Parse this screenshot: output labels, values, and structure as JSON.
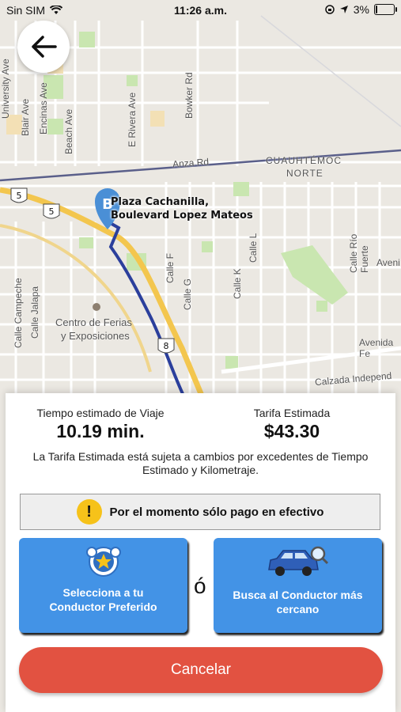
{
  "status_bar": {
    "carrier": "Sin SIM",
    "time": "11:26 a.m.",
    "battery": "3%",
    "battery_level": 0.03
  },
  "map": {
    "destination_marker": "B",
    "destination_label_line1": "Plaza Cachanilla,",
    "destination_label_line2": "Boulevard Lopez Mateos",
    "labels": {
      "university": "University Ave",
      "blair": "Blair Ave",
      "encinas": "Encinas Ave",
      "beach": "Beach Ave",
      "rivera": "E Rivera Ave",
      "bowker": "Bowker Rd",
      "anza": "Anza Rd",
      "cuauhtemoc1": "CUAUHTÉMOC",
      "cuauhtemoc2": "NORTE",
      "calle_f": "Calle F",
      "calle_g": "Calle G",
      "calle_l": "Calle L",
      "calle_k": "Calle K",
      "rio_fuerte": "Calle Río Fuerte",
      "avenida_right": "Aveni",
      "avenida_fe": "Avenida Fe",
      "campeche": "Calle Campeche",
      "jalapa": "Calle Jalapa",
      "ferias1": "Centro de Ferias",
      "ferias2": "y Exposiciones",
      "calzada": "Calzada Independ",
      "hwy5": "5",
      "hwy5b": "5",
      "hwy8": "8"
    }
  },
  "trip": {
    "time_label": "Tiempo estimado de Viaje",
    "time_value": "10.19 min.",
    "fare_label": "Tarifa Estimada",
    "fare_value": "$43.30",
    "note": "La Tarifa Estimada está sujeta a cambios por excedentes de Tiempo Estimado y Kilometraje."
  },
  "payment_notice": "Por el momento sólo pago en efectivo",
  "options": {
    "preferred_line1": "Selecciona a tu",
    "preferred_line2": "Conductor Preferido",
    "or": "ó",
    "nearest_line1": "Busca al Conductor más",
    "nearest_line2": "cercano"
  },
  "cancel_label": "Cancelar",
  "colors": {
    "primary_button": "#4393e6",
    "cancel": "#e25241",
    "route": "#2b3f9c",
    "notice_icon": "#f6c21a"
  }
}
